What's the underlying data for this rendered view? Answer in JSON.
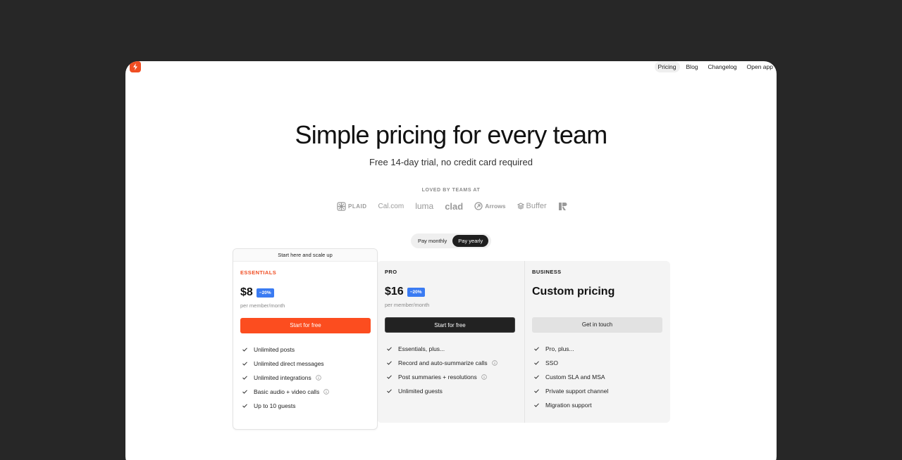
{
  "brand": {
    "accent": "#f04e23",
    "logo_icon": "bolt-icon"
  },
  "nav": {
    "items": [
      {
        "label": "Pricing",
        "active": true
      },
      {
        "label": "Blog"
      },
      {
        "label": "Changelog"
      },
      {
        "label": "Open app"
      }
    ]
  },
  "hero": {
    "title": "Simple pricing for every team",
    "subtitle": "Free 14-day trial, no credit card required"
  },
  "customers": {
    "label": "LOVED BY TEAMS AT",
    "logos": [
      "PLAID",
      "Cal.com",
      "luma",
      "clad",
      "Arrows",
      "Buffer",
      "R"
    ]
  },
  "billing_toggle": {
    "monthly": "Pay monthly",
    "yearly": "Pay yearly",
    "selected": "yearly"
  },
  "plans": [
    {
      "tag": "Start here and scale up",
      "name": "ESSENTIALS",
      "price": "$8",
      "discount": "−20%",
      "per": "per member/month",
      "cta": "Start for free",
      "features": [
        {
          "text": "Unlimited posts",
          "info": false
        },
        {
          "text": "Unlimited direct messages",
          "info": false
        },
        {
          "text": "Unlimited integrations",
          "info": true
        },
        {
          "text": "Basic audio + video calls",
          "info": true
        },
        {
          "text": "Up to 10 guests",
          "info": false
        }
      ]
    },
    {
      "name": "PRO",
      "price": "$16",
      "discount": "−20%",
      "per": "per member/month",
      "cta": "Start for free",
      "features": [
        {
          "text": "Essentials, plus...",
          "info": false
        },
        {
          "text": "Record and auto-summarize calls",
          "info": true
        },
        {
          "text": "Post summaries + resolutions",
          "info": true
        },
        {
          "text": "Unlimited guests",
          "info": false
        }
      ]
    },
    {
      "name": "BUSINESS",
      "price": "Custom pricing",
      "cta": "Get in touch",
      "features": [
        {
          "text": "Pro, plus...",
          "info": false
        },
        {
          "text": "SSO",
          "info": false
        },
        {
          "text": "Custom SLA and MSA",
          "info": false
        },
        {
          "text": "Private support channel",
          "info": false
        },
        {
          "text": "Migration support",
          "info": false
        }
      ]
    }
  ],
  "colors": {
    "background": "#272727",
    "cta_orange": "#fc4d1f",
    "cta_dark": "#222222",
    "discount_badge": "#3a7bf2"
  }
}
